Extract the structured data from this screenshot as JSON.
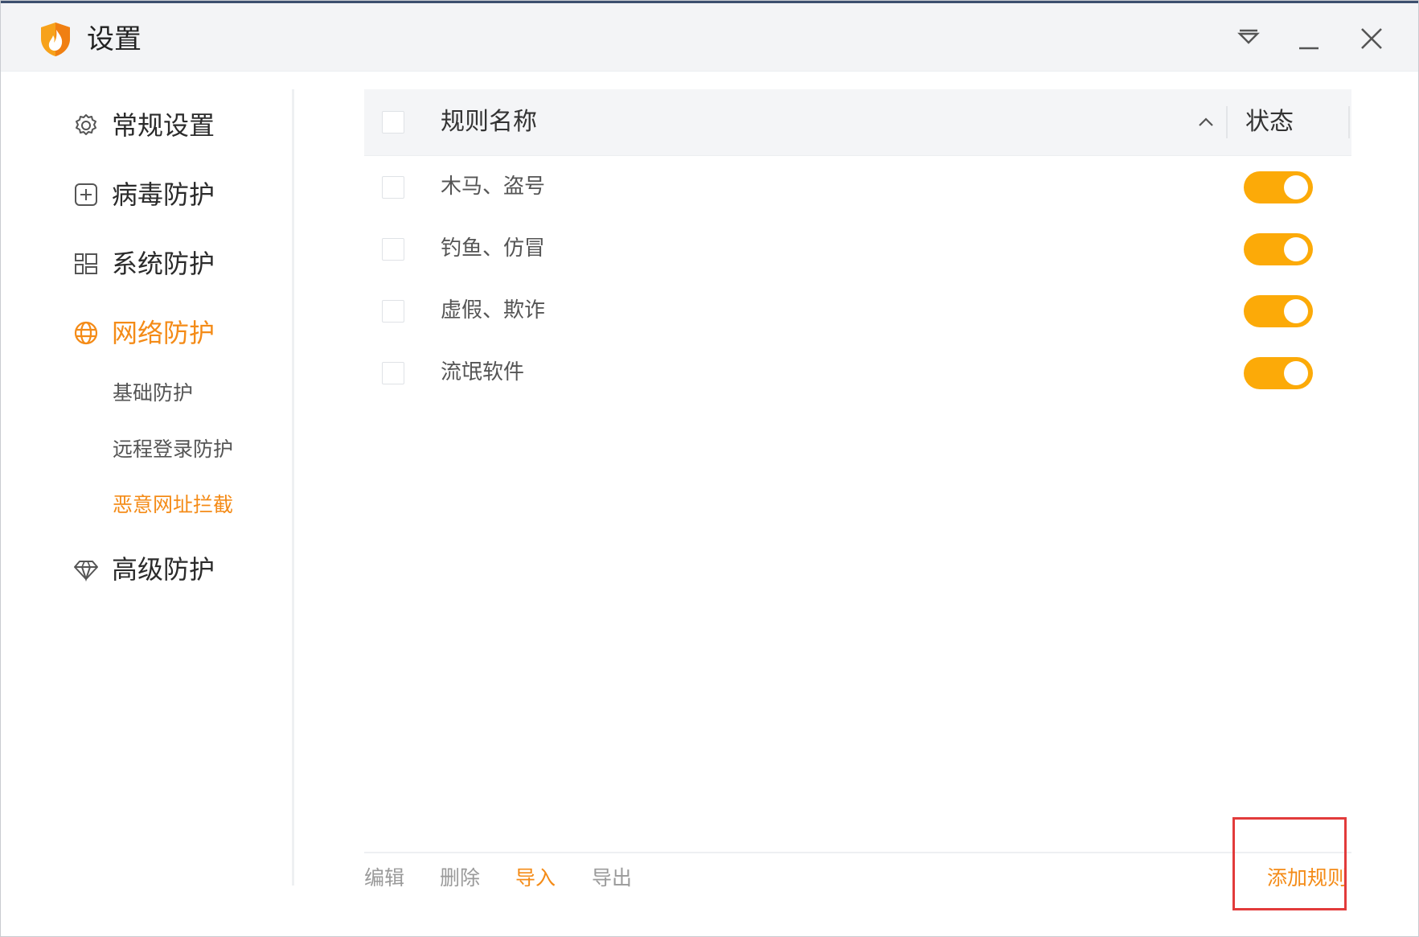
{
  "window": {
    "title": "设置",
    "logo_icon": "shield-flame-icon",
    "menu_icon": "triangle-down-icon",
    "minimize_icon": "minimize-icon",
    "close_icon": "close-icon"
  },
  "colors": {
    "accent": "#f48b17",
    "toggle_on": "#fcaa08",
    "highlight": "#e23b3b"
  },
  "sidebar": {
    "items": [
      {
        "label": "常规设置",
        "icon": "gear-icon",
        "active": false
      },
      {
        "label": "病毒防护",
        "icon": "plus-square-icon",
        "active": false
      },
      {
        "label": "系统防护",
        "icon": "grid-icon",
        "active": false
      },
      {
        "label": "网络防护",
        "icon": "globe-icon",
        "active": true,
        "subitems": [
          {
            "label": "基础防护",
            "active": false
          },
          {
            "label": "远程登录防护",
            "active": false
          },
          {
            "label": "恶意网址拦截",
            "active": true
          }
        ]
      },
      {
        "label": "高级防护",
        "icon": "diamond-icon",
        "active": false
      }
    ]
  },
  "table": {
    "columns": {
      "name": "规则名称",
      "status": "状态"
    },
    "sort_icon": "chevron-up-icon",
    "rows": [
      {
        "name": "木马、盗号",
        "enabled": true
      },
      {
        "name": "钓鱼、仿冒",
        "enabled": true
      },
      {
        "name": "虚假、欺诈",
        "enabled": true
      },
      {
        "name": "流氓软件",
        "enabled": true
      }
    ]
  },
  "footer": {
    "edit": "编辑",
    "delete": "删除",
    "import": "导入",
    "export": "导出",
    "add_rule": "添加规则"
  }
}
